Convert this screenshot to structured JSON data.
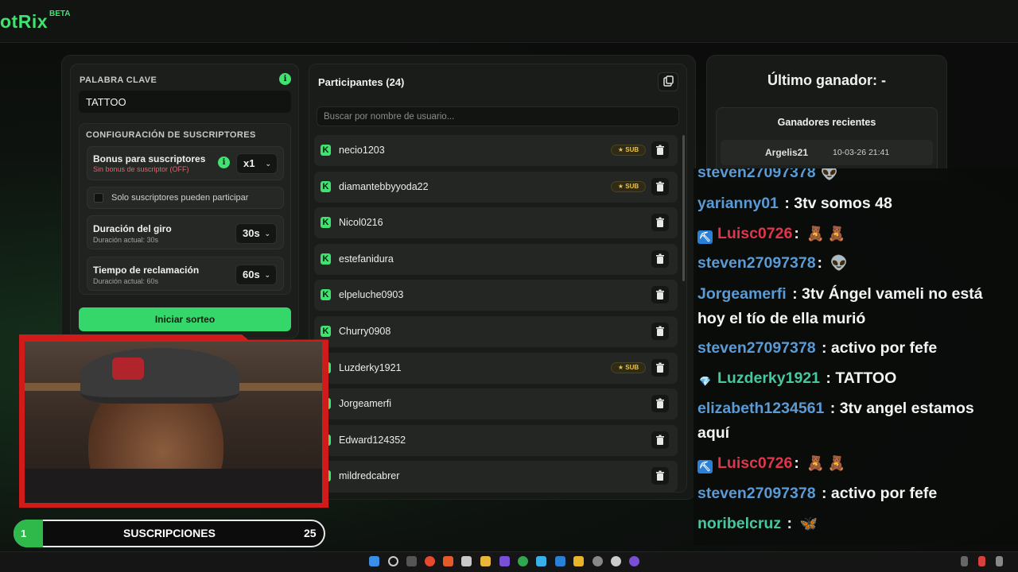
{
  "app": {
    "logo_text": "otRix",
    "logo_badge": "BETA"
  },
  "keyword": {
    "label": "PALABRA CLAVE",
    "value": "TATTOO"
  },
  "subs_config": {
    "title": "CONFIGURACIÓN DE SUSCRIPTORES",
    "bonus_title": "Bonus para suscriptores",
    "bonus_sub": "Sin bonus de suscriptor (OFF)",
    "bonus_value": "x1",
    "only_subs_label": "Solo suscriptores pueden participar",
    "spin_title": "Duración del giro",
    "spin_sub": "Duración actual: 30s",
    "spin_value": "30s",
    "claim_title": "Tiempo de reclamación",
    "claim_sub": "Duración actual: 60s",
    "claim_value": "60s"
  },
  "start_button": "Iniciar sorteo",
  "participants": {
    "title": "Participantes (24)",
    "search_placeholder": "Buscar por nombre de usuario...",
    "sub_badge": "★ SUB",
    "rows": [
      {
        "name": "necio1203",
        "sub": true
      },
      {
        "name": "diamantebbyyoda22",
        "sub": true
      },
      {
        "name": "Nicol0216",
        "sub": false
      },
      {
        "name": "estefanidura",
        "sub": false
      },
      {
        "name": "elpeluche0903",
        "sub": false
      },
      {
        "name": "Churry0908",
        "sub": false
      },
      {
        "name": "Luzderky1921",
        "sub": true
      },
      {
        "name": "Jorgeamerfi",
        "sub": false
      },
      {
        "name": "Edward124352",
        "sub": false
      },
      {
        "name": "mildredcabrer",
        "sub": false
      }
    ]
  },
  "winner": {
    "title": "Último ganador: -",
    "recent_title": "Ganadores recientes",
    "recent": [
      {
        "name": "Argelis21",
        "date": "10-03-26 21:41"
      }
    ]
  },
  "chat": [
    {
      "user": "steven27097378",
      "msg": "",
      "color": "blue",
      "badge": ""
    },
    {
      "user": "yarianny01",
      "msg": ": 3tv somos 48",
      "color": "blue",
      "badge": ""
    },
    {
      "user": "Luisc0726",
      "msg": ": ",
      "color": "red",
      "badge": "pick"
    },
    {
      "user": "steven27097378",
      "msg": ": ",
      "color": "blue",
      "badge": ""
    },
    {
      "user": "Jorgeamerfi",
      "msg": ": 3tv Ángel vameli no está",
      "color": "blue",
      "badge": ""
    },
    {
      "user": "",
      "msg": "hoy el tío de ella murió",
      "color": "blue",
      "badge": ""
    },
    {
      "user": "steven27097378",
      "msg": ": activo por fefe",
      "color": "blue",
      "badge": ""
    },
    {
      "user": "Luzderky1921",
      "msg": ": TATTOO",
      "color": "teal",
      "badge": "gem"
    },
    {
      "user": "elizabeth1234561",
      "msg": ": 3tv angel estamos",
      "color": "blue",
      "badge": ""
    },
    {
      "user": "",
      "msg": "aquí",
      "color": "blue",
      "badge": ""
    },
    {
      "user": "Luisc0726",
      "msg": ": ",
      "color": "red",
      "badge": "pick"
    },
    {
      "user": "steven27097378",
      "msg": ": activo por fefe",
      "color": "blue",
      "badge": ""
    },
    {
      "user": "noribelcruz",
      "msg": ": ",
      "color": "teal",
      "badge": ""
    }
  ],
  "subs_bar": {
    "count_left": "1",
    "label": "SUSCRIPCIONES",
    "count_right": "25"
  },
  "colors": {
    "accent": "#3ee46f",
    "danger": "#d01b1b",
    "gold": "#e9c34a"
  }
}
